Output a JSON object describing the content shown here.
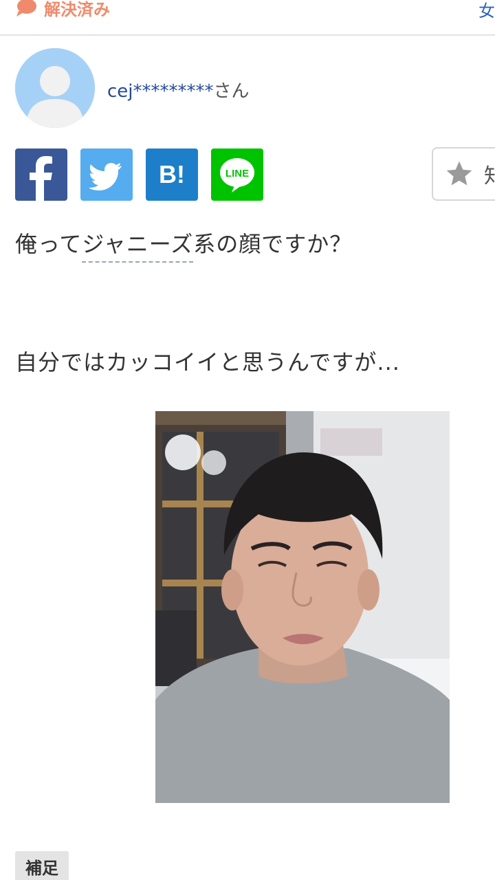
{
  "status": {
    "label": "解決済み",
    "icon": "speech-bubble-icon",
    "color": "#f08a6c"
  },
  "top_right_link": "女",
  "user": {
    "id": "cej*********",
    "suffix": "さん",
    "avatar_icon": "default-user-avatar"
  },
  "share_buttons": [
    {
      "name": "facebook",
      "label": "f",
      "color": "#3a5897"
    },
    {
      "name": "twitter",
      "label": "twitter",
      "color": "#55acee"
    },
    {
      "name": "hatena",
      "label": "B!",
      "color": "#1d7fca"
    },
    {
      "name": "line",
      "label": "LINE",
      "color": "#00c300"
    }
  ],
  "favorite": {
    "label": "知",
    "icon": "star-icon"
  },
  "question": {
    "line1_prefix": "俺って",
    "keyword": "ジャニーズ",
    "line1_suffix": "系の顔ですか？",
    "line2": "自分ではカッコイイと思うんですが..."
  },
  "photo": {
    "description_icon": "attached-photo"
  },
  "supplement_label": "補足"
}
